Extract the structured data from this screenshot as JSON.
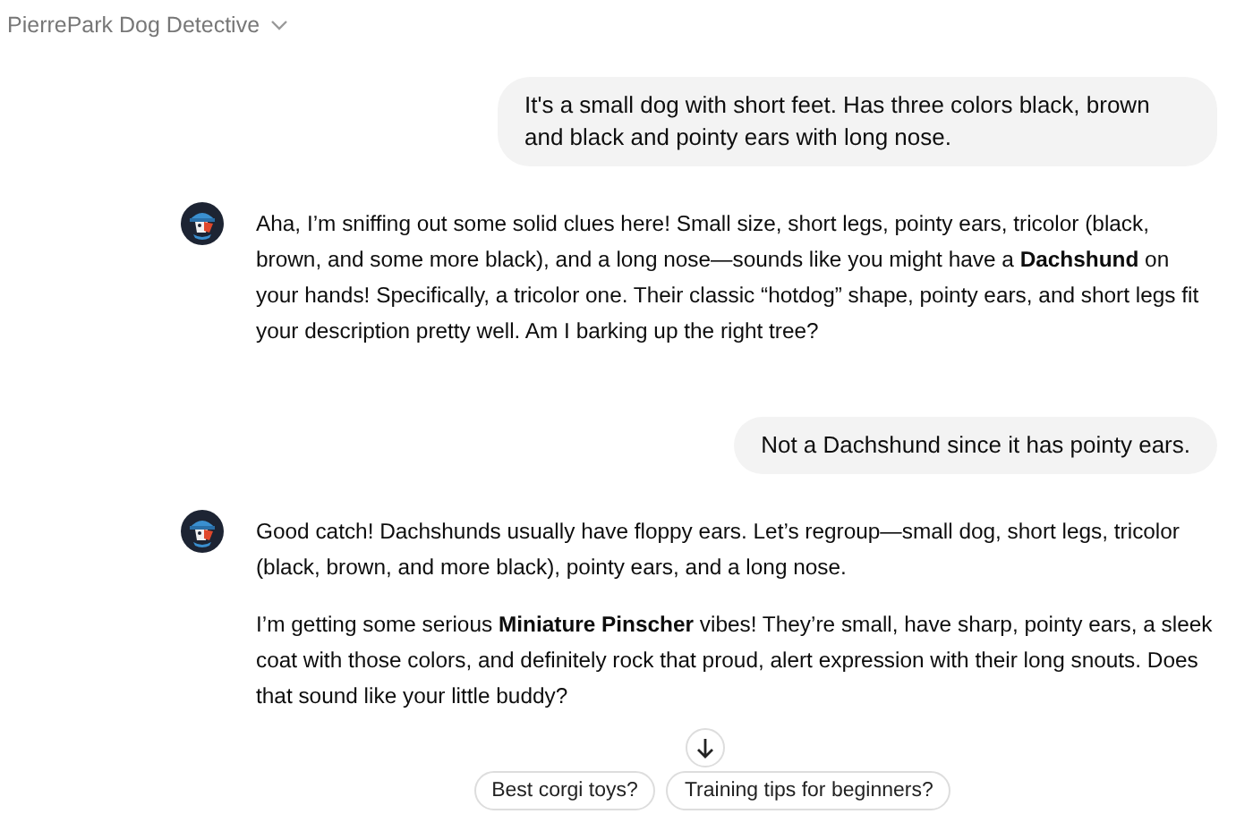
{
  "header": {
    "title": "PierrePark Dog Detective"
  },
  "messages": [
    {
      "kind": "user",
      "paragraphs": [
        "It's a small dog with short feet. Has three colors black, brown and black and pointy ears with long nose."
      ]
    },
    {
      "kind": "assistant",
      "paragraphs": [
        "Aha, I’m sniffing out some solid clues here! Small size, short legs, pointy ears, tricolor (black, brown, and some more black), and a long nose—sounds like you might have a **Dachshund** on your hands! Specifically, a tricolor one. Their classic “hotdog” shape, pointy ears, and short legs fit your description pretty well. Am I barking up the right tree?"
      ]
    },
    {
      "kind": "user",
      "paragraphs": [
        "Not a Dachshund since it has pointy ears."
      ]
    },
    {
      "kind": "assistant",
      "paragraphs": [
        "Good catch! Dachshunds usually have floppy ears. Let’s regroup—small dog, short legs, tricolor (black, brown, and more black), pointy ears, and a long nose.",
        "I’m getting some serious **Miniature Pinscher** vibes! They’re small, have sharp, pointy ears, a sleek coat with those colors, and definitely rock that proud, alert expression with their long snouts. Does that sound like your little buddy?"
      ]
    }
  ],
  "suggestions": [
    "Best corgi toys?",
    "Training tips for beginners?"
  ]
}
